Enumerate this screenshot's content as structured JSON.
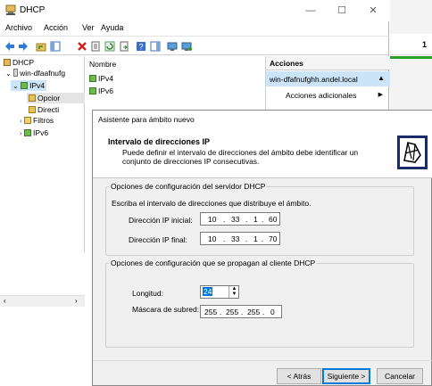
{
  "window": {
    "title": "DHCP",
    "minimize": "—",
    "maximize": "☐",
    "close": "✕"
  },
  "menu": [
    "Archivo",
    "Acción",
    "Ver",
    "Ayuda"
  ],
  "tree": {
    "root": "DHCP",
    "server": "win-dfaafnufg",
    "ipv4": "IPv4",
    "options": "Opcior",
    "policies": "Directi",
    "filters": "Filtros",
    "ipv6": "IPv6"
  },
  "list": {
    "header": "Nombre",
    "items": [
      "IPv4",
      "IPv6"
    ]
  },
  "actions": {
    "header": "Acciones",
    "selected": "win-dfafnufghh.andel.local",
    "more": "Acciones adicionales"
  },
  "other_window": {
    "text": "1"
  },
  "wizard": {
    "title": "Asistente para ámbito nuevo",
    "heading": "Intervalo de direcciones IP",
    "subheading": "Puede definir el intervalo de direcciones del ámbito debe identificar un conjunto de direcciones IP consecutivas.",
    "group1": {
      "legend": "Opciones de configuración del servidor DHCP",
      "description": "Escriba el intervalo de direcciones que distribuye el ámbito.",
      "start_label": "Dirección IP inicial:",
      "start_ip": [
        "10",
        "33",
        "1",
        "60"
      ],
      "end_label": "Dirección IP final:",
      "end_ip": [
        "10",
        "33",
        "1",
        "70"
      ]
    },
    "group2": {
      "legend": "Opciones de configuración que se propagan al cliente DHCP",
      "length_label": "Longitud:",
      "length_value": "24",
      "mask_label": "Máscara de subred:",
      "mask": [
        "255",
        "255",
        "255",
        "0"
      ]
    },
    "buttons": {
      "back": "< Atrás",
      "next": "Siguiente >",
      "cancel": "Cancelar"
    }
  },
  "colors": {
    "selection": "#cce4f7",
    "accent": "#0078d7",
    "dialog_bg": "#f0f0f0"
  }
}
